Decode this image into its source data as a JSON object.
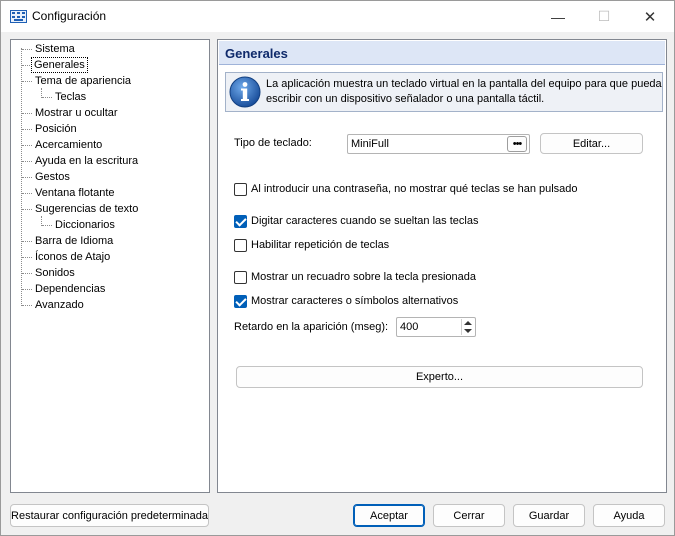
{
  "window": {
    "title": "Configuración",
    "minimize_glyph": "—",
    "maximize_glyph": "☐",
    "close_glyph": "✕",
    "icon": "keyboard-icon"
  },
  "sidebar": {
    "items": [
      {
        "label": "Sistema"
      },
      {
        "label": "Generales"
      },
      {
        "label": "Tema de apariencia"
      },
      {
        "label": "Teclas"
      },
      {
        "label": "Mostrar u ocultar"
      },
      {
        "label": "Posición"
      },
      {
        "label": "Acercamiento"
      },
      {
        "label": "Ayuda en la escritura"
      },
      {
        "label": "Gestos"
      },
      {
        "label": "Ventana flotante"
      },
      {
        "label": "Sugerencias de texto"
      },
      {
        "label": "Diccionarios"
      },
      {
        "label": "Barra de Idioma"
      },
      {
        "label": "Íconos de Atajo"
      },
      {
        "label": "Sonidos"
      },
      {
        "label": "Dependencias"
      },
      {
        "label": "Avanzado"
      }
    ],
    "selected": "Generales"
  },
  "panel": {
    "title": "Generales",
    "info_text": "La aplicación muestra un teclado virtual en la pantalla del equipo para que pueda escribir con un dispositivo señalador o una pantalla táctil.",
    "keyboard_type_label": "Tipo de teclado:",
    "keyboard_type_value": "MiniFull",
    "combo_button_label": "•••",
    "edit_button": "Editar...",
    "options": {
      "hide_password": {
        "label": "Al introducir una contraseña, no mostrar qué teclas se han pulsado",
        "checked": false
      },
      "type_on_release": {
        "label": "Digitar caracteres cuando se sueltan las teclas",
        "checked": true
      },
      "key_repeat": {
        "label": "Habilitar repetición de teclas",
        "checked": false
      },
      "show_box": {
        "label": "Mostrar un recuadro sobre la tecla presionada",
        "checked": false
      },
      "show_alt_chars": {
        "label": "Mostrar caracteres o símbolos alternativos",
        "checked": true
      }
    },
    "delay_label": "Retardo en la aparición (mseg):",
    "delay_value": "400",
    "expert_button": "Experto..."
  },
  "footer": {
    "restore_button": "Restaurar configuración predeterminada",
    "accept_button": "Aceptar",
    "cancel_button": "Cerrar",
    "save_button": "Guardar",
    "help_button": "Ayuda"
  },
  "colors": {
    "accent": "#005fb8",
    "header_bg": "#dde6f6",
    "header_text": "#0f2a6b"
  }
}
